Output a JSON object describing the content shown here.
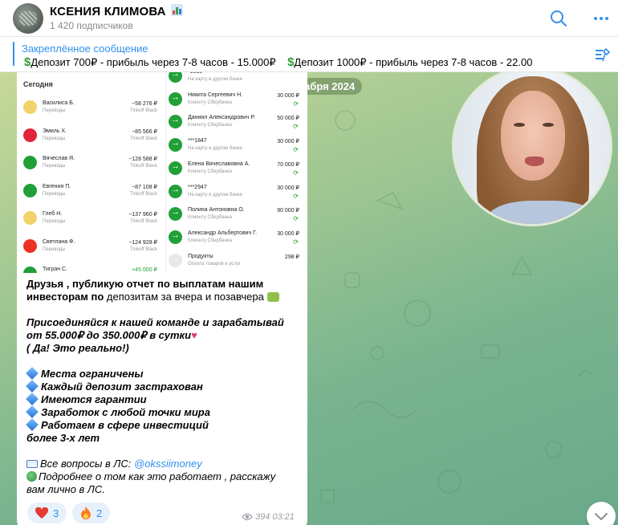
{
  "header": {
    "channel_name": "КСЕНИЯ КЛИМОВА",
    "subscribers": "1 420 подписчиков"
  },
  "pinned": {
    "label": "Закреплённое сообщение",
    "text_1": "Депозит 700₽ - прибыль  через 7-8 часов - 15.000₽",
    "text_2": "Депозит 1000₽ - прибыль через 7-8 часов - 22.00"
  },
  "chat": {
    "date": "01 декабря 2024"
  },
  "screenshot": {
    "today_label": "Сегодня",
    "outgoing": [
      {
        "name": "Василиса Б.",
        "category": "Переводы",
        "amount": "−58 276 ₽",
        "bank": "Tinkoff Black",
        "color": "#f2d36b"
      },
      {
        "name": "Эмиль Х.",
        "category": "Переводы",
        "amount": "−85 566 ₽",
        "bank": "Tinkoff Black",
        "color": "#e0243a"
      },
      {
        "name": "Вячеслав Я.",
        "category": "Переводы",
        "amount": "−128 588 ₽",
        "bank": "Tinkoff Black",
        "color": "#21a038"
      },
      {
        "name": "Евгения П.",
        "category": "Переводы",
        "amount": "−87 108 ₽",
        "bank": "Tinkoff Black",
        "color": "#21a038"
      },
      {
        "name": "Глеб Н.",
        "category": "Переводы",
        "amount": "−137 960 ₽",
        "bank": "Tinkoff Black",
        "color": "#f2d36b"
      },
      {
        "name": "Светлана Ф.",
        "category": "Переводы",
        "amount": "−124 928 ₽",
        "bank": "Tinkoff Black",
        "color": "#ef3124"
      },
      {
        "name": "Тигран С.",
        "category": "",
        "amount": "+45 000 ₽",
        "bank": "",
        "color": "#21a038"
      }
    ],
    "incoming": [
      {
        "name": "*1815",
        "category": "На карту в другом банке",
        "amount": "",
        "check": ""
      },
      {
        "name": "Никита Сергеевич Н.",
        "category": "Клиенту Сбербанка",
        "amount": "30 000 ₽",
        "check": "⟳"
      },
      {
        "name": "Даниил Александрович Р.",
        "category": "Клиенту Сбербанка",
        "amount": "50 000 ₽",
        "check": "⟳"
      },
      {
        "name": "***1847",
        "category": "На карту в другом банке",
        "amount": "30 000 ₽",
        "check": "⟳"
      },
      {
        "name": "Елена Вячеславовна А.",
        "category": "Клиенту Сбербанка",
        "amount": "70 000 ₽",
        "check": "⟳"
      },
      {
        "name": "***2947",
        "category": "На карту в другом банке",
        "amount": "30 000 ₽",
        "check": "⟳"
      },
      {
        "name": "Полина Антоновна О.",
        "category": "Клиенту Сбербанка",
        "amount": "90 000 ₽",
        "check": "⟳"
      },
      {
        "name": "Александр Альбертович Г.",
        "category": "Клиенту Сбербанка",
        "amount": "30 000 ₽",
        "check": "⟳"
      },
      {
        "name": "Продукты",
        "category": "Оплата товаров и услуг",
        "amount": "298 ₽",
        "check": ""
      }
    ]
  },
  "message": {
    "line1_bold": "Друзья , публикую  отчет по выплатам нашим",
    "line2_bold": "инвесторам по",
    "line2_rest": " депозитам за вчера и позавчера",
    "join_1": "Присоединяйся к нашей команде и зарабатывай",
    "join_2": "от 55.000₽ до 350.000₽ в сутки",
    "real": "( Да! Это реально!)",
    "bullets": [
      "Места ограничены",
      "Каждый депозит застрахован",
      "Имеются гарантии",
      "Заработок с любой точки мира",
      "Работаем в сфере инвестиций"
    ],
    "bullet_tail": "более 3-х лет",
    "questions": "Все вопросы в ЛС: ",
    "handle": "@okssiimoney",
    "details_1": "Подробнее о том как это работает , расскажу",
    "details_2": "вам лично в ЛС."
  },
  "reactions": [
    {
      "emoji": "heart-icon",
      "count": "3"
    },
    {
      "emoji": "fire-icon",
      "count": "2"
    }
  ],
  "meta": {
    "views": "394",
    "time": "03:21"
  }
}
